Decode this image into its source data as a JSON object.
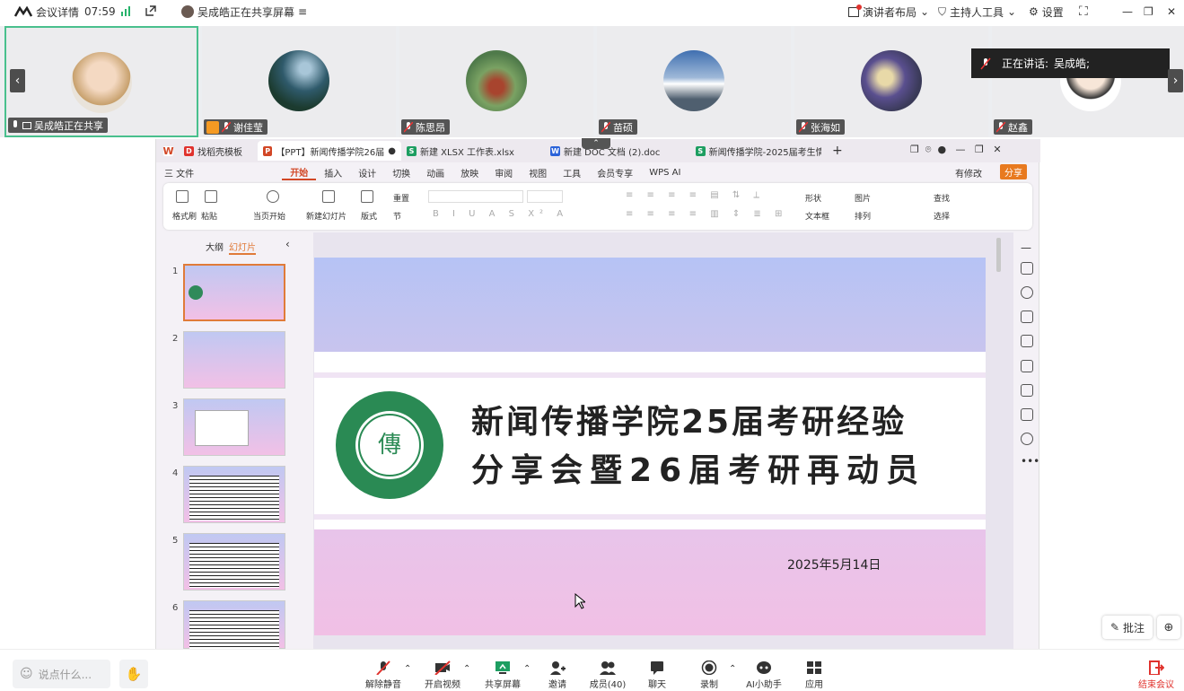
{
  "topbar": {
    "logo_text": "会议详情",
    "time": "07:59",
    "share_notice": "吴成皓正在共享屏幕",
    "layout_label": "演讲者布局",
    "host_tools_label": "主持人工具",
    "settings_label": "设置"
  },
  "participants": [
    {
      "name": "吴成皓正在共享"
    },
    {
      "name": "谢佳莹"
    },
    {
      "name": "陈思昂"
    },
    {
      "name": "苗硕"
    },
    {
      "name": "张海如"
    },
    {
      "name": "赵鑫"
    }
  ],
  "speaking_banner": {
    "label": "正在讲话:",
    "name": "吴成皓;"
  },
  "wps": {
    "tabs": [
      {
        "label": "找稻壳模板",
        "icon": "wps-logo"
      },
      {
        "label": "【PPT】新闻传播学院26届考研",
        "icon": "P",
        "color": "#d24726"
      },
      {
        "label": "新建 XLSX 工作表.xlsx",
        "icon": "S",
        "color": "#1d9e61"
      },
      {
        "label": "新建 DOC 文档 (2).doc",
        "icon": "W",
        "color": "#2b63d9"
      },
      {
        "label": "新闻传播学院-2025届考生情况",
        "icon": "S",
        "color": "#1d9e61"
      }
    ],
    "menu": [
      "三 文件",
      "开始",
      "插入",
      "设计",
      "切换",
      "动画",
      "放映",
      "审阅",
      "视图",
      "工具",
      "会员专享",
      "WPS AI"
    ],
    "menu_right": [
      "有修改",
      "分享"
    ],
    "ribbon": [
      "格式刷",
      "粘贴",
      "当页开始",
      "新建幻灯片",
      "版式",
      "节",
      "重置",
      "形状",
      "图片",
      "文本框",
      "排列",
      "查找",
      "选择"
    ],
    "panel_tabs": [
      "大纲",
      "幻灯片"
    ],
    "slide_numbers": [
      "1",
      "2",
      "3",
      "4",
      "5",
      "6"
    ]
  },
  "slide": {
    "title_line1": "新闻传播学院25届考研经验",
    "title_line2": "分享会暨26届考研再动员",
    "date": "2025年5月14日",
    "seal_text": "COMMUNICATIONS COLLEGE"
  },
  "annotate_label": "批注",
  "bottom": {
    "chat_placeholder": "说点什么...",
    "buttons": [
      "解除静音",
      "开启视频",
      "共享屏幕",
      "邀请",
      "成员(40)",
      "聊天",
      "录制",
      "AI小助手",
      "应用"
    ],
    "end_label": "结束会议"
  },
  "colors": {
    "accent": "#49c08d",
    "wps_red": "#d24726",
    "end_red": "#e0322d"
  }
}
